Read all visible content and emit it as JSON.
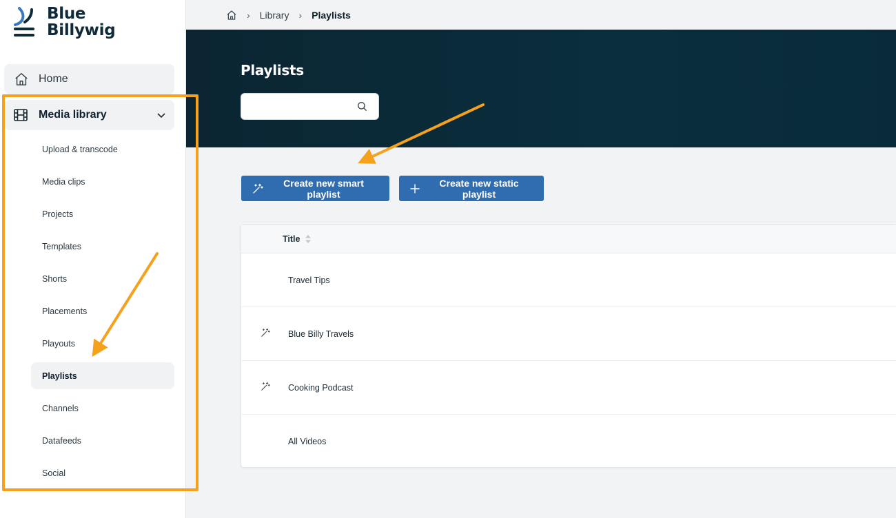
{
  "brand": {
    "line1": "Blue",
    "line2": "Billywig"
  },
  "sidebar": {
    "home_label": "Home",
    "media_label": "Media library",
    "items": [
      {
        "label": "Upload & transcode"
      },
      {
        "label": "Media clips"
      },
      {
        "label": "Projects"
      },
      {
        "label": "Templates"
      },
      {
        "label": "Shorts"
      },
      {
        "label": "Placements"
      },
      {
        "label": "Playouts"
      },
      {
        "label": "Playlists"
      },
      {
        "label": "Channels"
      },
      {
        "label": "Datafeeds"
      },
      {
        "label": "Social"
      }
    ]
  },
  "breadcrumb": {
    "level1": "Library",
    "current": "Playlists"
  },
  "hero": {
    "title": "Playlists",
    "search_value": ""
  },
  "actions": {
    "smart_label": "Create new smart playlist",
    "static_label": "Create new static playlist"
  },
  "table": {
    "header_title": "Title",
    "rows": [
      {
        "title": "Travel Tips",
        "type_icon": "none"
      },
      {
        "title": "Blue Billy Travels",
        "type_icon": "magic-wand-icon"
      },
      {
        "title": "Cooking Podcast",
        "type_icon": "magic-wand-icon"
      },
      {
        "title": "All Videos",
        "type_icon": "none"
      }
    ]
  },
  "colors": {
    "accent": "#2f6db0",
    "hero_bg": "#0b2532",
    "annotation": "#f5a11c"
  }
}
